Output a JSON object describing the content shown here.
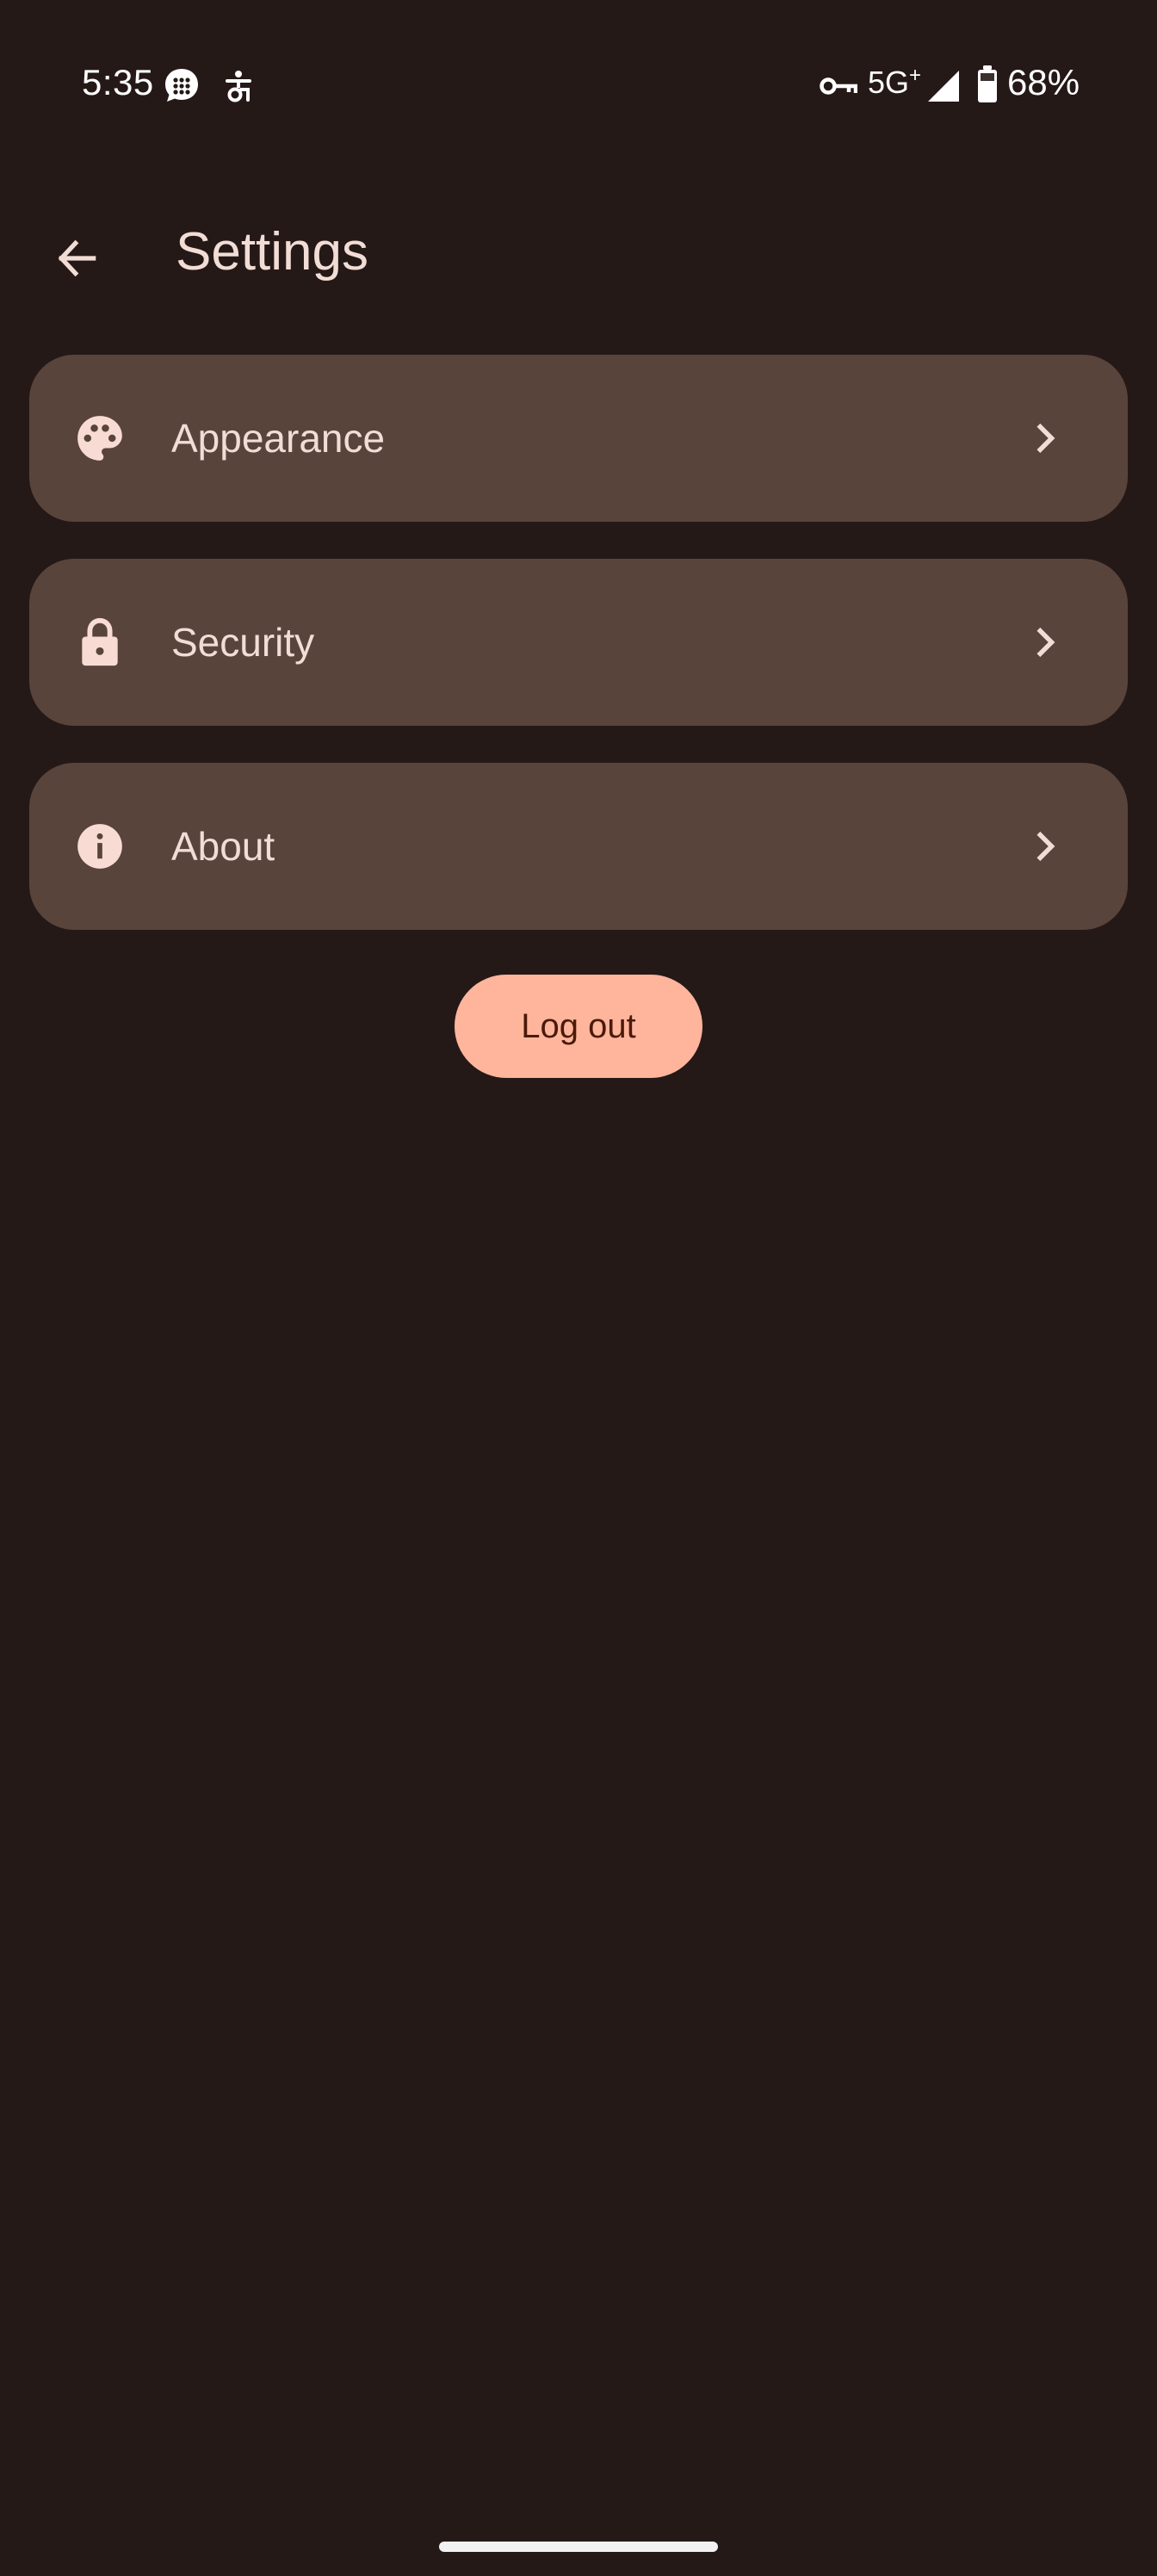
{
  "status_bar": {
    "time": "5:35",
    "network": "5G",
    "network_superscript": "+",
    "battery_percent": "68%",
    "icons": [
      "messages-icon",
      "data-saver-icon",
      "vpn-key-icon",
      "signal-icon",
      "battery-icon"
    ]
  },
  "top_bar": {
    "title": "Settings",
    "back_icon": "arrow-back-icon"
  },
  "settings": {
    "items": [
      {
        "label": "Appearance",
        "icon": "palette-icon"
      },
      {
        "label": "Security",
        "icon": "lock-icon"
      },
      {
        "label": "About",
        "icon": "info-icon"
      }
    ]
  },
  "actions": {
    "logout_label": "Log out"
  },
  "colors": {
    "background": "#251917",
    "card": "#59443c",
    "text": "#f2ddd6",
    "accent": "#ffb59c",
    "accent_text": "#4a1a0a"
  }
}
